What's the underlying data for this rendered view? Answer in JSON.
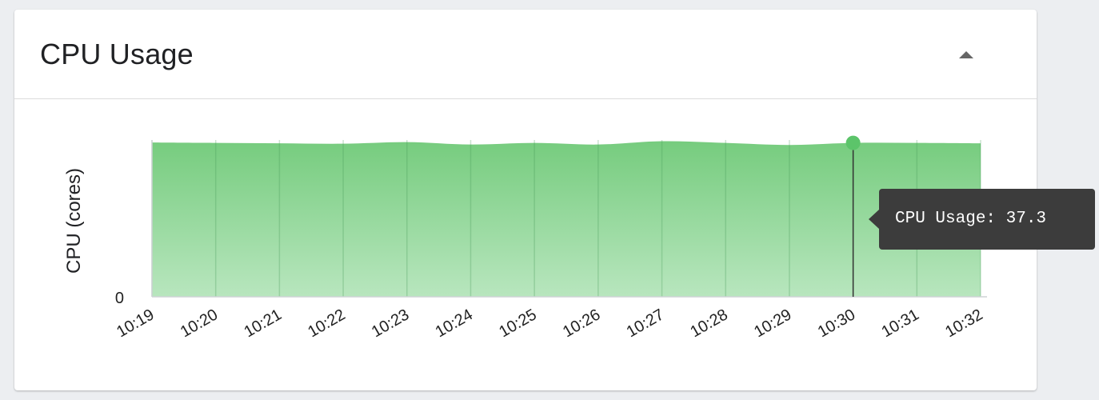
{
  "card": {
    "title": "CPU Usage",
    "collapse_icon": "caret-up-icon"
  },
  "tooltip": {
    "label": "CPU Usage",
    "value": "37.3",
    "text": "CPU Usage: 37.3"
  },
  "colors": {
    "area_top": "#76cc7e",
    "area_bottom": "#b8e6be",
    "point": "#5cc46a",
    "tooltip_bg": "#3c3c3c"
  },
  "chart_data": {
    "type": "area",
    "title": "",
    "xlabel": "",
    "ylabel": "CPU (cores)",
    "x": [
      "10:19",
      "10:20",
      "10:21",
      "10:22",
      "10:23",
      "10:24",
      "10:25",
      "10:26",
      "10:27",
      "10:28",
      "10:29",
      "10:30",
      "10:31",
      "10:32"
    ],
    "series": [
      {
        "name": "CPU Usage",
        "values": [
          37.4,
          37.3,
          37.2,
          37.1,
          37.5,
          36.9,
          37.3,
          36.9,
          37.7,
          37.3,
          36.8,
          37.3,
          37.3,
          37.2
        ]
      }
    ],
    "y_ticks": [
      "0"
    ],
    "ylim": [
      0,
      38
    ],
    "grid": "vertical",
    "highlighted_x": "10:30",
    "highlighted_value": 37.3
  }
}
